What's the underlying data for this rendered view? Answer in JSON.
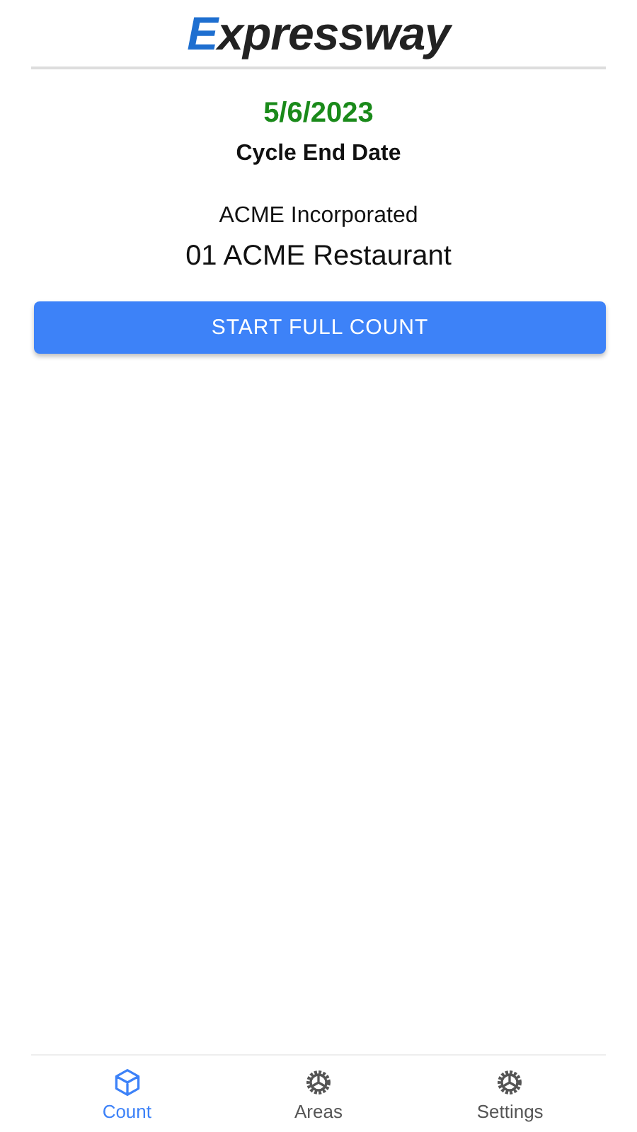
{
  "header": {
    "logo": "Expressway"
  },
  "cycle": {
    "date": "5/6/2023",
    "label": "Cycle End Date"
  },
  "company": {
    "name": "ACME Incorporated",
    "location": "01 ACME Restaurant"
  },
  "button": {
    "label": "START FULL COUNT"
  },
  "nav": [
    {
      "label": "Count",
      "kind": "box",
      "selected": true
    },
    {
      "label": "Areas",
      "kind": "gear",
      "selected": false
    },
    {
      "label": "Settings",
      "kind": "gear",
      "selected": false
    }
  ]
}
